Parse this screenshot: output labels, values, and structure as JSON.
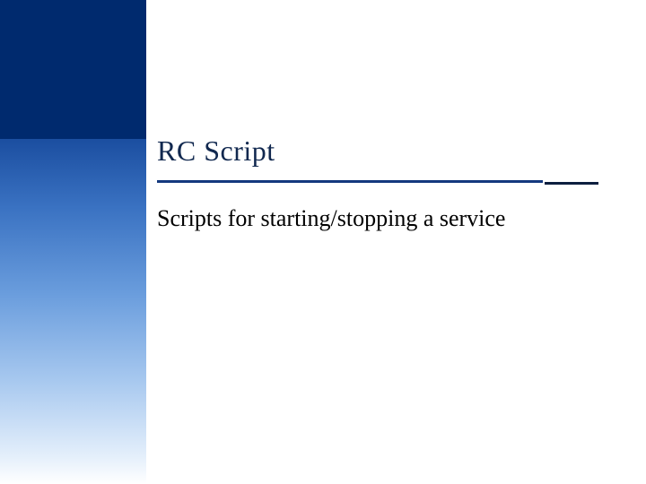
{
  "slide": {
    "title": "RC Script",
    "subtitle": "Scripts for starting/stopping a service"
  },
  "colors": {
    "topBand": "#002a6e",
    "rule": "#14387e",
    "titleText": "#11284f"
  }
}
